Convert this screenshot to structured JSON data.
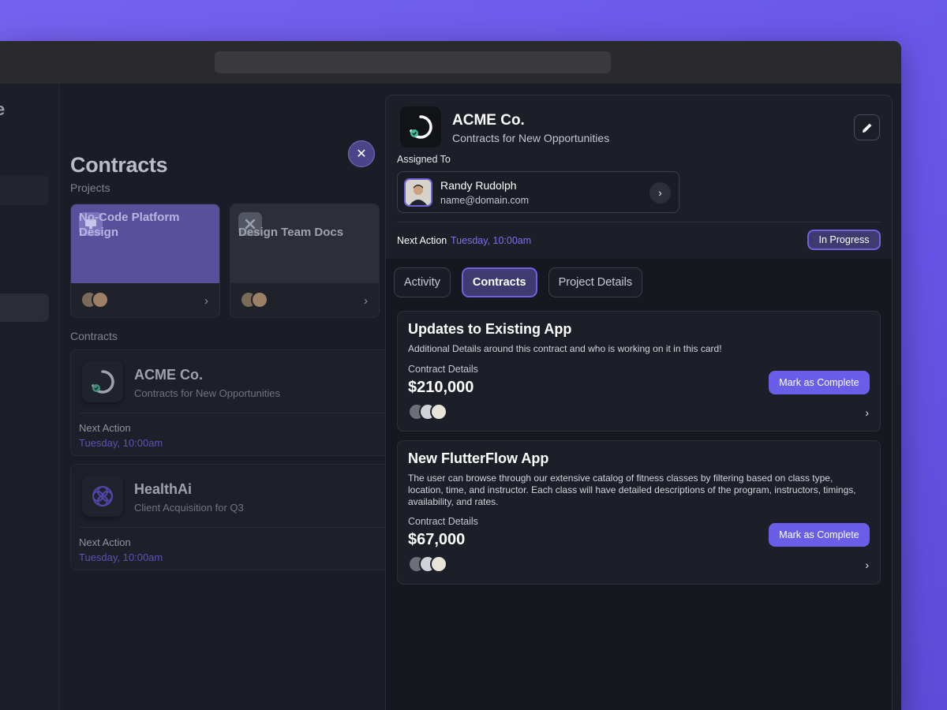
{
  "left_rail": {
    "letter": "e"
  },
  "list": {
    "title": "Contracts",
    "projects_label": "Projects",
    "projects": [
      {
        "name": "No-Code Platform Design",
        "icon": "monitor-icon"
      },
      {
        "name": "Design Team Docs",
        "icon": "puzzle-icon"
      }
    ],
    "contracts_label": "Contracts",
    "contracts": [
      {
        "name": "ACME Co.",
        "subtitle": "Contracts for New Opportunities",
        "next_action_label": "Next Action",
        "next_action_time": "Tuesday, 10:00am",
        "icon": "progress-ring-icon"
      },
      {
        "name": "HealthAi",
        "subtitle": "Client Acquisition for Q3",
        "next_action_label": "Next Action",
        "next_action_time": "Tuesday, 10:00am",
        "icon": "flower-logo-icon"
      }
    ]
  },
  "detail": {
    "title": "ACME Co.",
    "subtitle": "Contracts for New Opportunities",
    "assigned_label": "Assigned To",
    "assignee": {
      "name": "Randy Rudolph",
      "email": "name@domain.com"
    },
    "next_action_label": "Next Action",
    "next_action_time": "Tuesday, 10:00am",
    "status": "In Progress",
    "tabs": [
      {
        "label": "Activity"
      },
      {
        "label": "Contracts"
      },
      {
        "label": "Project Details"
      }
    ],
    "active_tab": "Contracts",
    "contracts": [
      {
        "title": "Updates to Existing App",
        "description": "Additional Details around this contract and who is working on it in this card!",
        "details_label": "Contract Details",
        "amount": "$210,000",
        "button": "Mark as Complete"
      },
      {
        "title": "New FlutterFlow App",
        "description": "The user can browse through our extensive catalog of fitness classes by filtering based on class type, location, time, and instructor. Each class will have detailed descriptions of the program, instructors, timings, availability, and rates.",
        "details_label": "Contract Details",
        "amount": "$67,000",
        "button": "Mark as Complete"
      }
    ]
  },
  "colors": {
    "accent": "#6a5ee8",
    "accent_text": "#7b70f0",
    "background": "#6a57ea"
  }
}
